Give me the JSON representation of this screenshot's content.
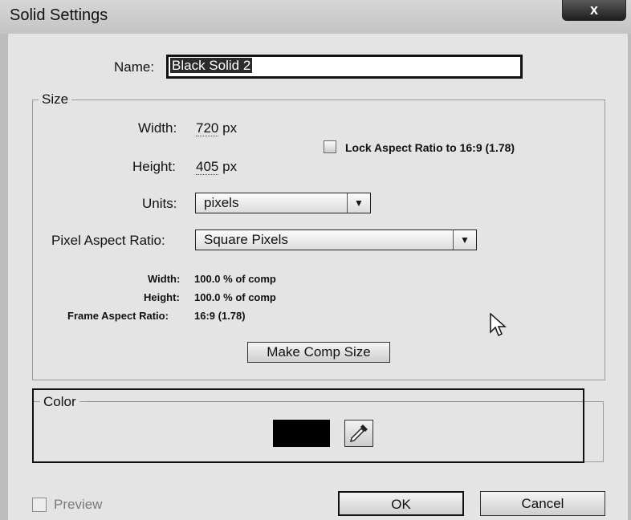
{
  "window": {
    "title": "Solid Settings",
    "close_label": "x"
  },
  "name": {
    "label": "Name:",
    "value": "Black Solid 2"
  },
  "size": {
    "legend": "Size",
    "width_label": "Width:",
    "width_value": "720",
    "height_label": "Height:",
    "height_value": "405",
    "unit_px": "px",
    "lock_label": "Lock Aspect Ratio to 16:9 (1.78)",
    "lock_checked": false,
    "units_label": "Units:",
    "units_value": "pixels",
    "par_label": "Pixel Aspect Ratio:",
    "par_value": "Square Pixels",
    "info": {
      "width_label": "Width:",
      "width_value": "100.0 % of comp",
      "height_label": "Height:",
      "height_value": "100.0 % of comp",
      "far_label": "Frame Aspect Ratio:",
      "far_value": "16:9 (1.78)"
    },
    "make_comp_label": "Make Comp Size"
  },
  "color": {
    "legend": "Color",
    "swatch": "#000000"
  },
  "footer": {
    "preview_label": "Preview",
    "ok_label": "OK",
    "cancel_label": "Cancel"
  }
}
